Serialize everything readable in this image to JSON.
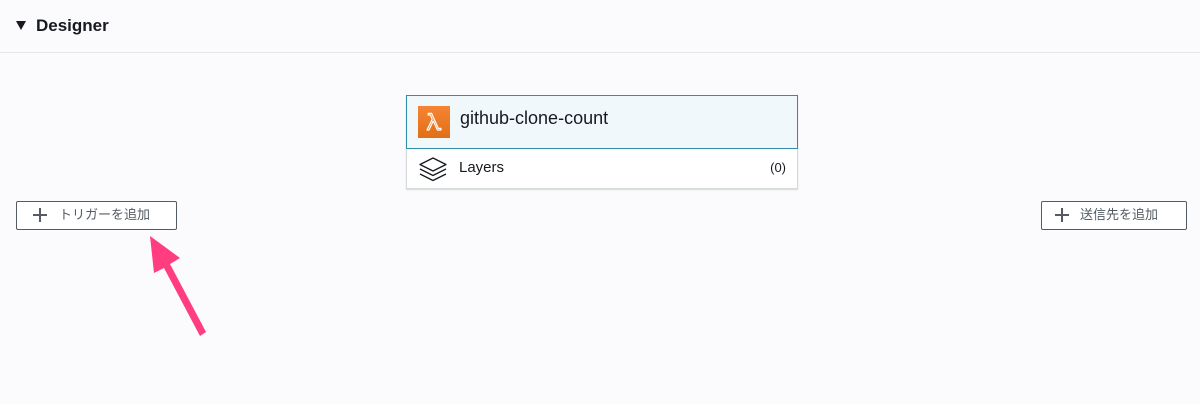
{
  "designer": {
    "title": "Designer"
  },
  "function_card": {
    "name": "github-clone-count",
    "icon": "lambda-icon",
    "icon_color": "#f58534",
    "layers_label": "Layers",
    "layers_count": "(0)"
  },
  "buttons": {
    "add_trigger": "トリガーを追加",
    "add_destination": "送信先を追加"
  },
  "annotation": {
    "arrow_color": "#ff3d7f"
  }
}
